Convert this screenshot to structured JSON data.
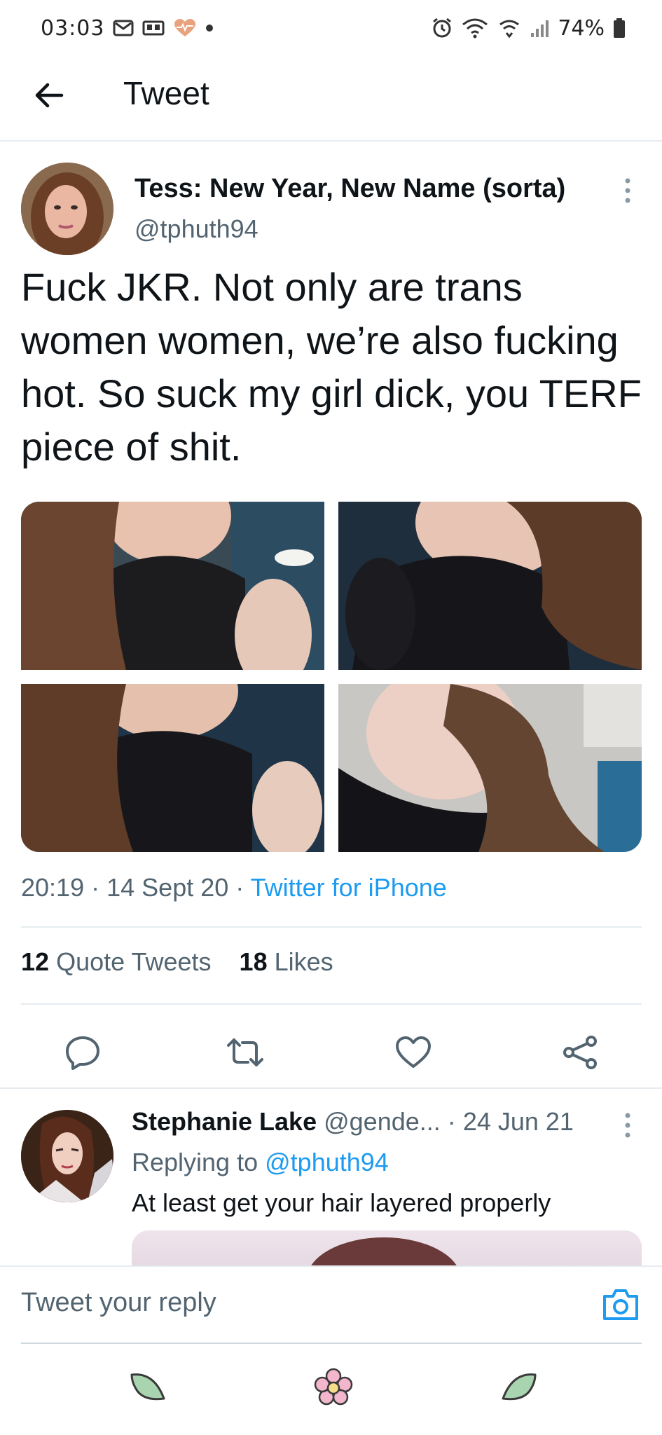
{
  "status_bar": {
    "time": "03:03",
    "battery": "74%",
    "icons": [
      "mail-icon",
      "vr-icon",
      "heart-rate-icon",
      "dot-icon",
      "alarm-icon",
      "wifi-icon",
      "wifi-calling-icon",
      "signal-icon",
      "battery-icon"
    ]
  },
  "header": {
    "title": "Tweet",
    "back_icon": "arrow-left-icon"
  },
  "tweet": {
    "author_name": "Tess: New Year, New Name (sorta)",
    "handle": "@tphuth94",
    "text": "Fuck JKR. Not only are trans women women, we’re also fucking hot. So suck my girl dick, you TERF piece of shit.",
    "time": "20:19",
    "date": "14 Sept 20",
    "sep": "·",
    "source": "Twitter for iPhone",
    "photos_count": 4,
    "quote_count": "12",
    "quote_label": "Quote Tweets",
    "likes_count": "18",
    "likes_label": "Likes"
  },
  "actions": [
    {
      "name": "reply-icon"
    },
    {
      "name": "retweet-icon"
    },
    {
      "name": "like-icon"
    },
    {
      "name": "share-icon"
    }
  ],
  "reply": {
    "author_name": "Stephanie Lake",
    "handle": "@gende...",
    "sep": "·",
    "date": "24 Jun 21",
    "replying_label": "Replying to",
    "replying_handle": "@tphuth94",
    "text": "At least get your hair layered properly"
  },
  "composer": {
    "placeholder": "Tweet your reply",
    "camera_icon": "camera-icon"
  },
  "bottom_nav": [
    {
      "name": "leaf-icon",
      "color": "#a9d4b0"
    },
    {
      "name": "flower-icon",
      "color": "#f3b6cc"
    },
    {
      "name": "leaf-right-icon",
      "color": "#a9d4b0"
    }
  ],
  "colors": {
    "accent": "#1d9bf0",
    "text": "#0f1419",
    "secondary": "#536471",
    "divider": "#e6ecf0"
  }
}
